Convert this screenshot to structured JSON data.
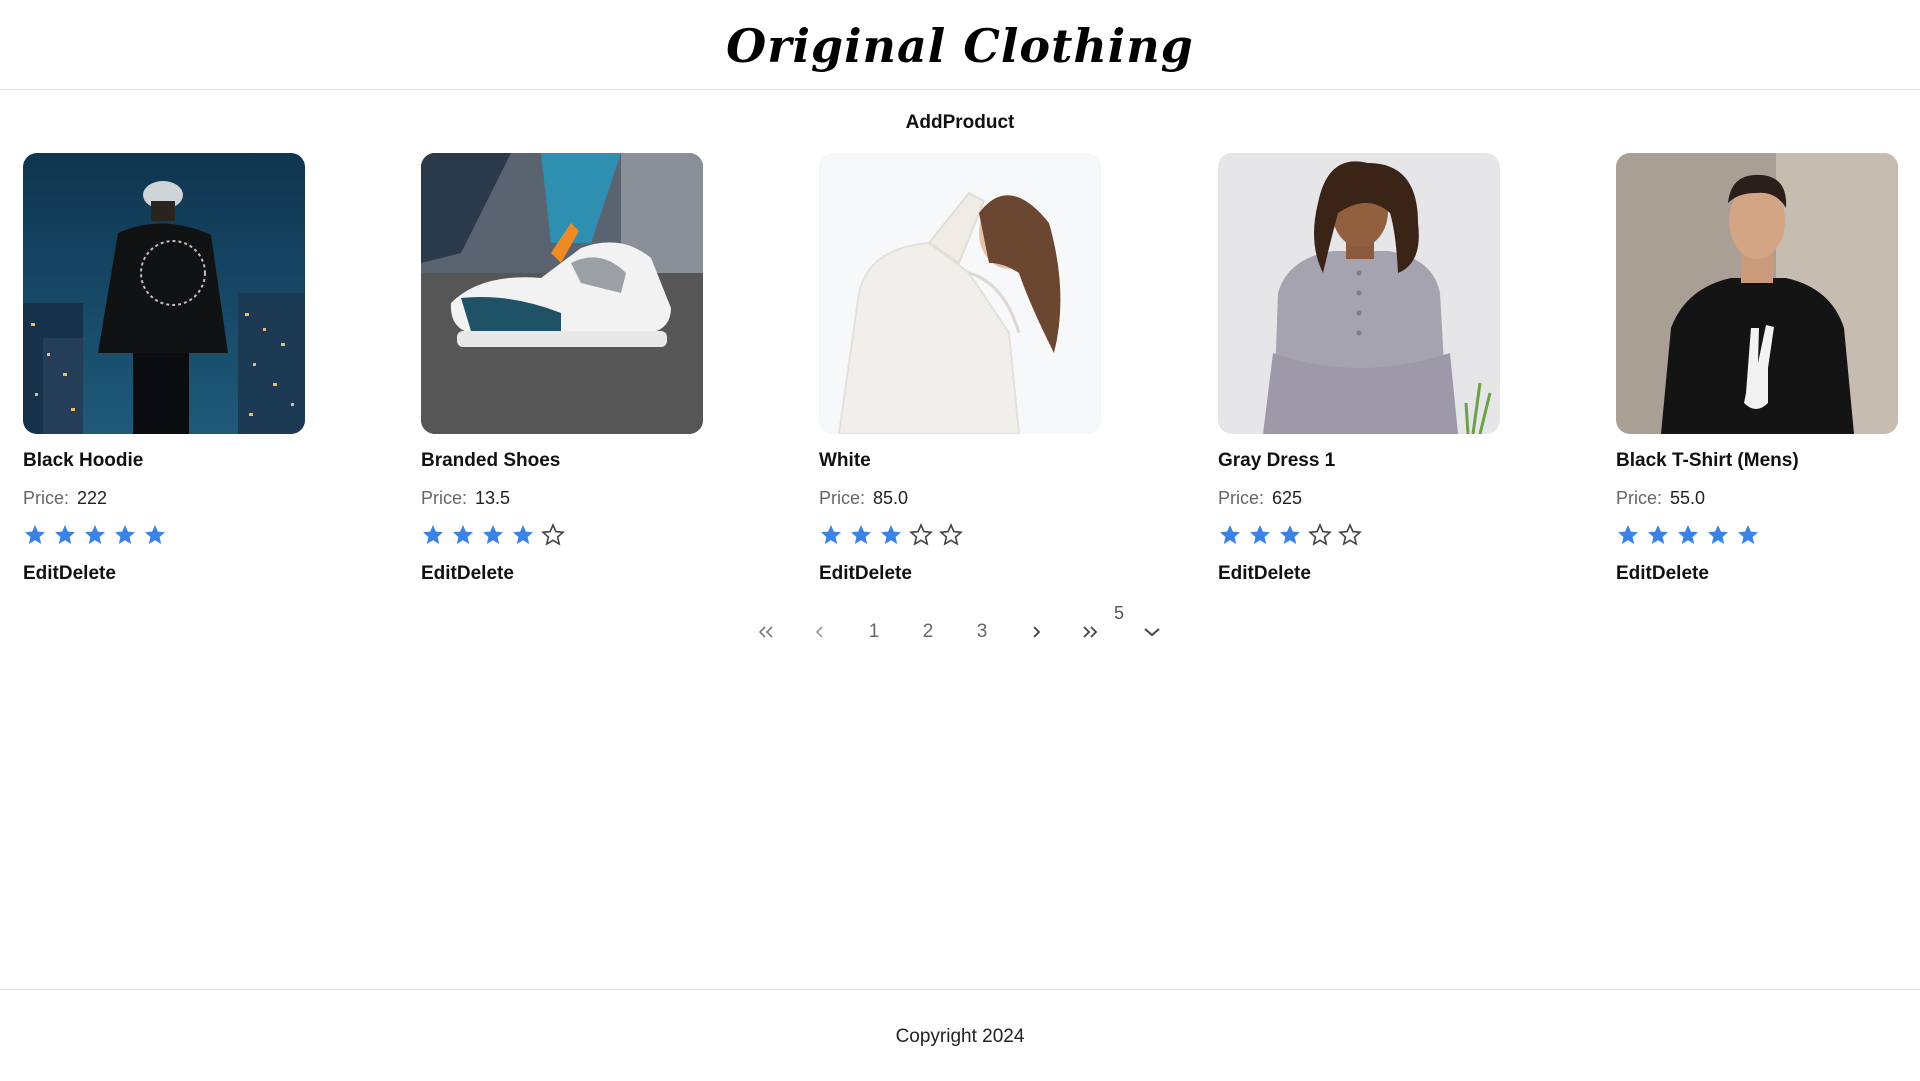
{
  "header": {
    "brand": "Original Clothing"
  },
  "toolbar": {
    "add_product_label": "AddProduct"
  },
  "price_label": "Price:",
  "products": [
    {
      "name": "Black Hoodie",
      "price": "222",
      "rating": 5,
      "image": "black-hoodie-photo",
      "edit_label": "Edit",
      "delete_label": "Delete"
    },
    {
      "name": "Branded Shoes",
      "price": "13.5",
      "rating": 4,
      "image": "branded-shoes-photo",
      "edit_label": "Edit",
      "delete_label": "Delete"
    },
    {
      "name": "White",
      "price": "85.0",
      "rating": 3,
      "image": "white-sweater-photo",
      "edit_label": "Edit",
      "delete_label": "Delete"
    },
    {
      "name": "Gray Dress 1",
      "price": "625",
      "rating": 3,
      "image": "gray-dress-photo",
      "edit_label": "Edit",
      "delete_label": "Delete"
    },
    {
      "name": "Black T-Shirt (Mens)",
      "price": "55.0",
      "rating": 5,
      "image": "black-tshirt-photo",
      "edit_label": "Edit",
      "delete_label": "Delete"
    }
  ],
  "pagination": {
    "pages": [
      "1",
      "2",
      "3"
    ],
    "page_size": "5",
    "icons": [
      "first-page-icon",
      "prev-page-icon",
      "next-page-icon",
      "last-page-icon",
      "chevron-down-icon"
    ]
  },
  "colors": {
    "star": "#3b82e6",
    "text": "#111111",
    "muted": "#666666",
    "divider": "#e2e2e2"
  },
  "footer": {
    "copyright": "Copyright 2024"
  }
}
